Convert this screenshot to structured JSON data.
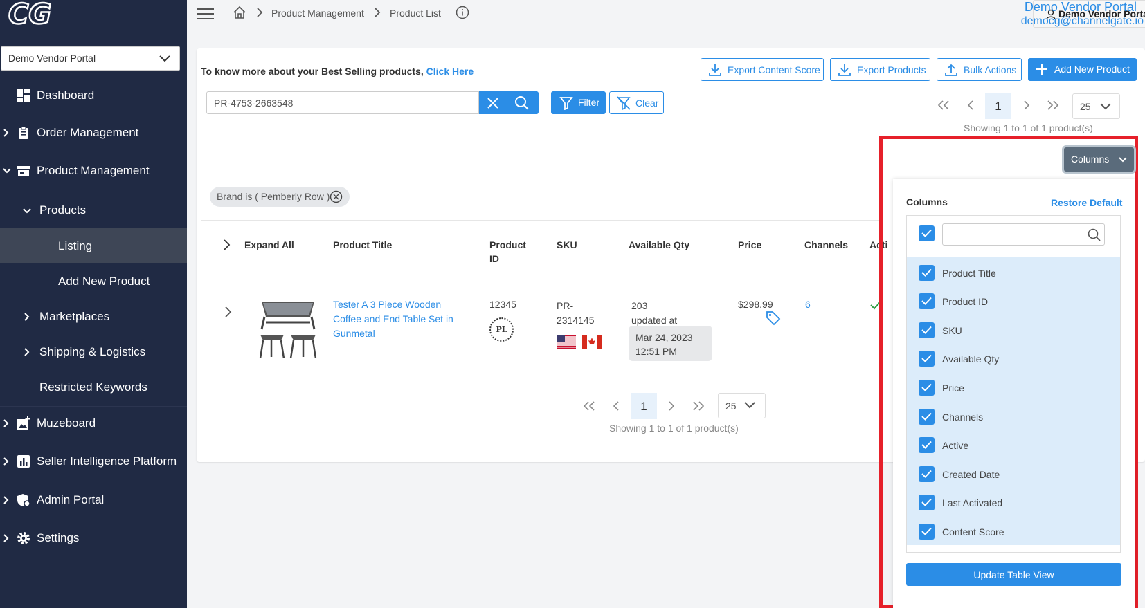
{
  "sidebar": {
    "logo_text": "CG",
    "account_select": "Demo Vendor Portal",
    "items": [
      {
        "label": "Dashboard",
        "icon": "dashboard-icon"
      },
      {
        "label": "Order Management",
        "icon": "clipboard-icon"
      },
      {
        "label": "Product Management",
        "icon": "store-icon"
      },
      {
        "label": "Products"
      },
      {
        "label": "Listing"
      },
      {
        "label": "Add New Product"
      },
      {
        "label": "Marketplaces"
      },
      {
        "label": "Shipping & Logistics"
      },
      {
        "label": "Restricted Keywords"
      },
      {
        "label": "Muzeboard",
        "icon": "image-plus-icon"
      },
      {
        "label": "Seller Intelligence Platform",
        "icon": "bar-chart-icon"
      },
      {
        "label": "Admin Portal",
        "icon": "shield-gear-icon"
      },
      {
        "label": "Settings",
        "icon": "gear-icon"
      }
    ]
  },
  "header": {
    "breadcrumb": [
      "Product Management",
      "Product List"
    ],
    "vendor_button": "Demo Vendor Portal",
    "user_title": "Demo Vendor Portal",
    "user_email": "democg@channelgate.io"
  },
  "toolbar": {
    "best_selling_text": "To know more about your Best Selling products,",
    "best_selling_link": "Click Here",
    "export_content_score": "Export Content Score",
    "export_products": "Export Products",
    "bulk_actions": "Bulk Actions",
    "add_new_product": "Add New Product",
    "search_value": "PR-4753-2663548",
    "filter": "Filter",
    "clear": "Clear"
  },
  "pagination": {
    "page": "1",
    "page_size": "25",
    "showing": "Showing 1 to 1 of 1 product(s)"
  },
  "filter_chip": "Brand is ( Pemberly Row )",
  "table": {
    "headers": {
      "expand_all": "Expand All",
      "product_title": "Product Title",
      "product_id": "Product ID",
      "sku": "SKU",
      "available_qty": "Available Qty",
      "price": "Price",
      "channels": "Channels",
      "active": "Acti"
    },
    "rows": [
      {
        "title": "Tester A 3 Piece Wooden Coffee and End Table Set in Gunmetal",
        "product_id": "12345",
        "badge": "PL",
        "sku": "PR-2314145",
        "qty": "203",
        "updated_label": "updated at",
        "updated_date": "Mar 24, 2023",
        "updated_time": "12:51 PM",
        "price": "$298.99",
        "channels": "6"
      }
    ]
  },
  "columns_popup": {
    "button": "Columns",
    "title": "Columns",
    "restore": "Restore Default",
    "search_placeholder": "",
    "items": [
      {
        "label": "Product Title",
        "checked": true
      },
      {
        "label": "Product ID",
        "checked": true
      },
      {
        "label": "SKU",
        "checked": true
      },
      {
        "label": "Available Qty",
        "checked": true
      },
      {
        "label": "Price",
        "checked": true
      },
      {
        "label": "Channels",
        "checked": true
      },
      {
        "label": "Active",
        "checked": true
      },
      {
        "label": "Created Date",
        "checked": true
      },
      {
        "label": "Last Activated",
        "checked": true
      },
      {
        "label": "Content Score",
        "checked": true
      }
    ],
    "update": "Update Table View"
  },
  "colors": {
    "sidebar": "#202a44",
    "accent": "#2b8de6",
    "highlight_frame": "#e6202a"
  }
}
